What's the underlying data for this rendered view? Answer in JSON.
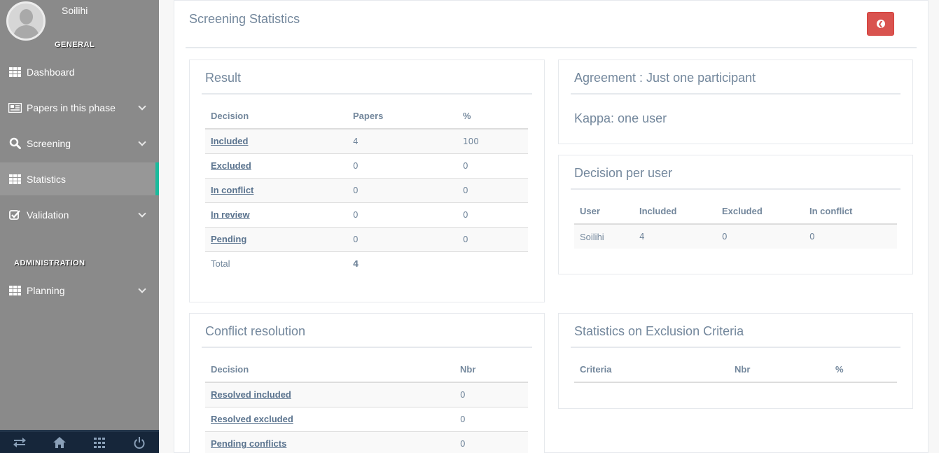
{
  "sidebar": {
    "username": "Soilihi",
    "general_title": "GENERAL",
    "admin_title": "ADMINISTRATION",
    "items": [
      {
        "label": "Dashboard",
        "icon": "grid-icon"
      },
      {
        "label": "Papers in this phase",
        "icon": "newspaper-icon"
      },
      {
        "label": "Screening",
        "icon": "search-icon"
      },
      {
        "label": "Statistics",
        "icon": "grid-icon"
      },
      {
        "label": "Validation",
        "icon": "check-square-icon"
      }
    ],
    "admin_items": [
      {
        "label": "Planning",
        "icon": "grid-icon"
      }
    ],
    "footer_icons": [
      "exchange-icon",
      "home-icon",
      "grid-icon",
      "power-icon"
    ]
  },
  "page": {
    "title": "Screening Statistics",
    "back_icon": "arrow-circle-left-icon",
    "back_color": "#d9534f",
    "active_accent": "#1abb9c"
  },
  "result": {
    "title": "Result",
    "headers": [
      "Decision",
      "Papers",
      "%"
    ],
    "rows": [
      {
        "decision": "Included",
        "papers": "4",
        "pct": "100"
      },
      {
        "decision": "Excluded",
        "papers": "0",
        "pct": "0"
      },
      {
        "decision": "In conflict",
        "papers": "0",
        "pct": "0"
      },
      {
        "decision": "In review",
        "papers": "0",
        "pct": "0"
      },
      {
        "decision": "Pending",
        "papers": "0",
        "pct": "0"
      }
    ],
    "total_label": "Total",
    "total_value": "4"
  },
  "agreement": {
    "title": "Agreement : Just one participant",
    "kappa": "Kappa: one user"
  },
  "decision_per_user": {
    "title": "Decision per user",
    "headers": [
      "User",
      "Included",
      "Excluded",
      "In conflict"
    ],
    "rows": [
      {
        "user": "Soilihi",
        "included": "4",
        "excluded": "0",
        "conflict": "0"
      }
    ]
  },
  "conflict_resolution": {
    "title": "Conflict resolution",
    "headers": [
      "Decision",
      "Nbr"
    ],
    "rows": [
      {
        "decision": "Resolved included",
        "nbr": "0"
      },
      {
        "decision": "Resolved excluded",
        "nbr": "0"
      },
      {
        "decision": "Pending conflicts",
        "nbr": "0"
      }
    ]
  },
  "exclusion_criteria": {
    "title": "Statistics on Exclusion Criteria",
    "headers": [
      "Criteria",
      "Nbr",
      "%"
    ]
  }
}
